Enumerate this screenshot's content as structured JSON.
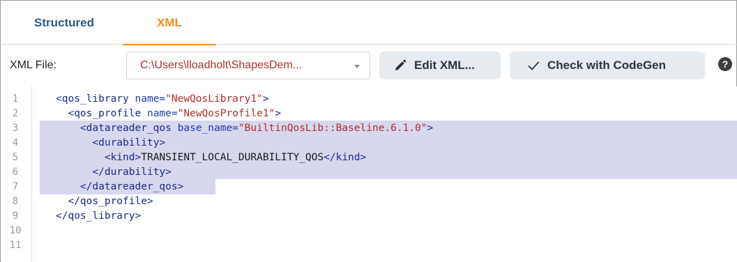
{
  "tabs": [
    {
      "label": "Structured",
      "active": false
    },
    {
      "label": "XML",
      "active": true
    }
  ],
  "toolbar": {
    "file_label": "XML File:",
    "file_value": "C:\\Users\\lloadholt\\ShapesDem...",
    "edit_button": "Edit XML...",
    "check_button": "Check with CodeGen",
    "help_icon": "?"
  },
  "editor": {
    "line_numbers": [
      "1",
      "2",
      "3",
      "4",
      "5",
      "6",
      "7",
      "8",
      "9",
      "10",
      "11"
    ],
    "lines": [
      {
        "indent": "",
        "open": "<qos_library",
        "attr": " name=",
        "val": "\"NewQosLibrary1\"",
        "close": ">",
        "text": ""
      },
      {
        "indent": "  ",
        "open": "<qos_profile",
        "attr": " name=",
        "val": "\"NewQosProfile1\"",
        "close": ">",
        "text": ""
      },
      {
        "indent": "    ",
        "open": "<datareader_qos",
        "attr": " base_name=",
        "val": "\"BuiltinQosLib::Baseline.6.1.0\"",
        "close": ">",
        "text": ""
      },
      {
        "indent": "      ",
        "open": "<durability>",
        "attr": "",
        "val": "",
        "close": "",
        "text": ""
      },
      {
        "indent": "        ",
        "open": "<kind>",
        "attr": "",
        "val": "",
        "close": "</kind>",
        "text": "TRANSIENT_LOCAL_DURABILITY_QOS"
      },
      {
        "indent": "      ",
        "open": "</durability>",
        "attr": "",
        "val": "",
        "close": "",
        "text": ""
      },
      {
        "indent": "    ",
        "open": "</datareader_qos>",
        "attr": "",
        "val": "",
        "close": "",
        "text": ""
      },
      {
        "indent": "  ",
        "open": "</qos_profile>",
        "attr": "",
        "val": "",
        "close": "",
        "text": ""
      },
      {
        "indent": "",
        "open": "</qos_library>",
        "attr": "",
        "val": "",
        "close": "",
        "text": ""
      }
    ],
    "selected_lines": [
      3,
      7
    ]
  },
  "colors": {
    "active_tab": "#e8901c",
    "inactive_tab": "#2a5b86",
    "selection": "#d7d7ee",
    "button_bg": "#e6ebf0"
  }
}
